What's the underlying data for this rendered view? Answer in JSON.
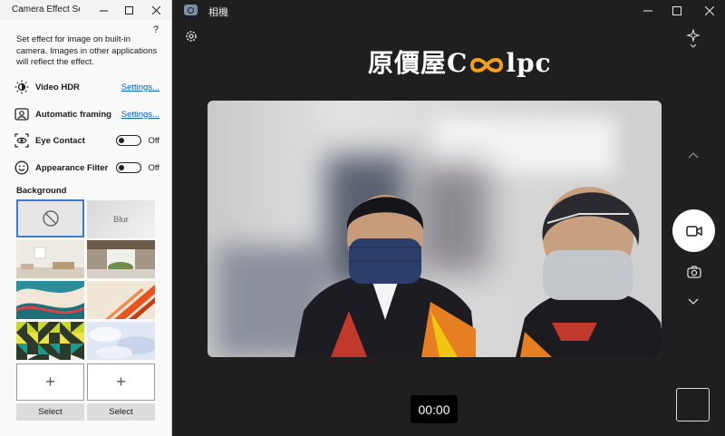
{
  "camera_app": {
    "title": "相機",
    "timer": "00:00",
    "logo": {
      "left": "原價屋",
      "c": "C",
      "right": "lpc"
    }
  },
  "effects_window": {
    "title": "Camera Effect Settings",
    "help": "?",
    "description": "Set effect for image on built-in camera. Images in other applications will reflect the effect.",
    "settings": [
      {
        "label": "Video HDR",
        "action": "Settings...",
        "icon": "brightness-icon"
      },
      {
        "label": "Automatic framing",
        "action": "Settings...",
        "icon": "framing-icon"
      },
      {
        "label": "Eye Contact",
        "toggle": "Off",
        "icon": "eye-contact-icon"
      },
      {
        "label": "Appearance Filter",
        "toggle": "Off",
        "icon": "smiley-icon"
      }
    ],
    "background_label": "Background",
    "backgrounds": {
      "none_icon": "no-background-icon",
      "blur_label": "Blur"
    },
    "custom": [
      {
        "add": "+",
        "select": "Select"
      },
      {
        "add": "+",
        "select": "Select"
      }
    ]
  }
}
